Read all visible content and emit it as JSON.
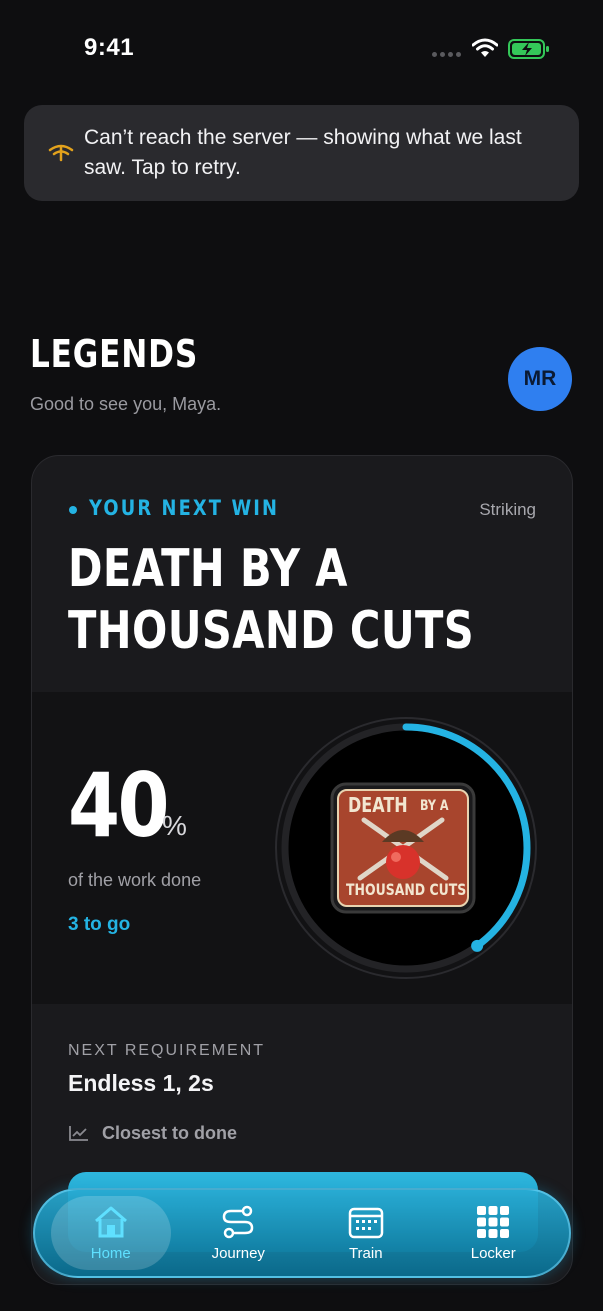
{
  "status": {
    "time": "9:41"
  },
  "banner": {
    "message": "Can’t reach the server — showing what we last saw. Tap to retry."
  },
  "header": {
    "brand": "LEGENDS",
    "greeting": "Good to see you, Maya.",
    "avatar_initials": "MR"
  },
  "card": {
    "eyebrow": "YOUR NEXT WIN",
    "category": "Striking",
    "title": "DEATH BY A THOUSAND CUTS",
    "progress": {
      "percent": 40,
      "percent_display": "40",
      "percent_sign": "%",
      "caption": "of the work done",
      "remaining": "3 to go"
    },
    "badge": {
      "top_text": "DEATH",
      "by_text": "BY A",
      "bottom_text": "THOUSAND CUTS"
    },
    "requirement": {
      "label": "NEXT REQUIREMENT",
      "value": "Endless 1, 2s",
      "hint": "Closest to done"
    }
  },
  "tabs": [
    {
      "label": "Home",
      "icon": "home-icon",
      "active": true
    },
    {
      "label": "Journey",
      "icon": "journey-icon",
      "active": false
    },
    {
      "label": "Train",
      "icon": "calendar-icon",
      "active": false
    },
    {
      "label": "Locker",
      "icon": "grid-icon",
      "active": false
    }
  ],
  "colors": {
    "accent": "#24b3e3",
    "avatar": "#2f7ff0",
    "warning": "#e3a21c",
    "battery": "#34c759"
  }
}
